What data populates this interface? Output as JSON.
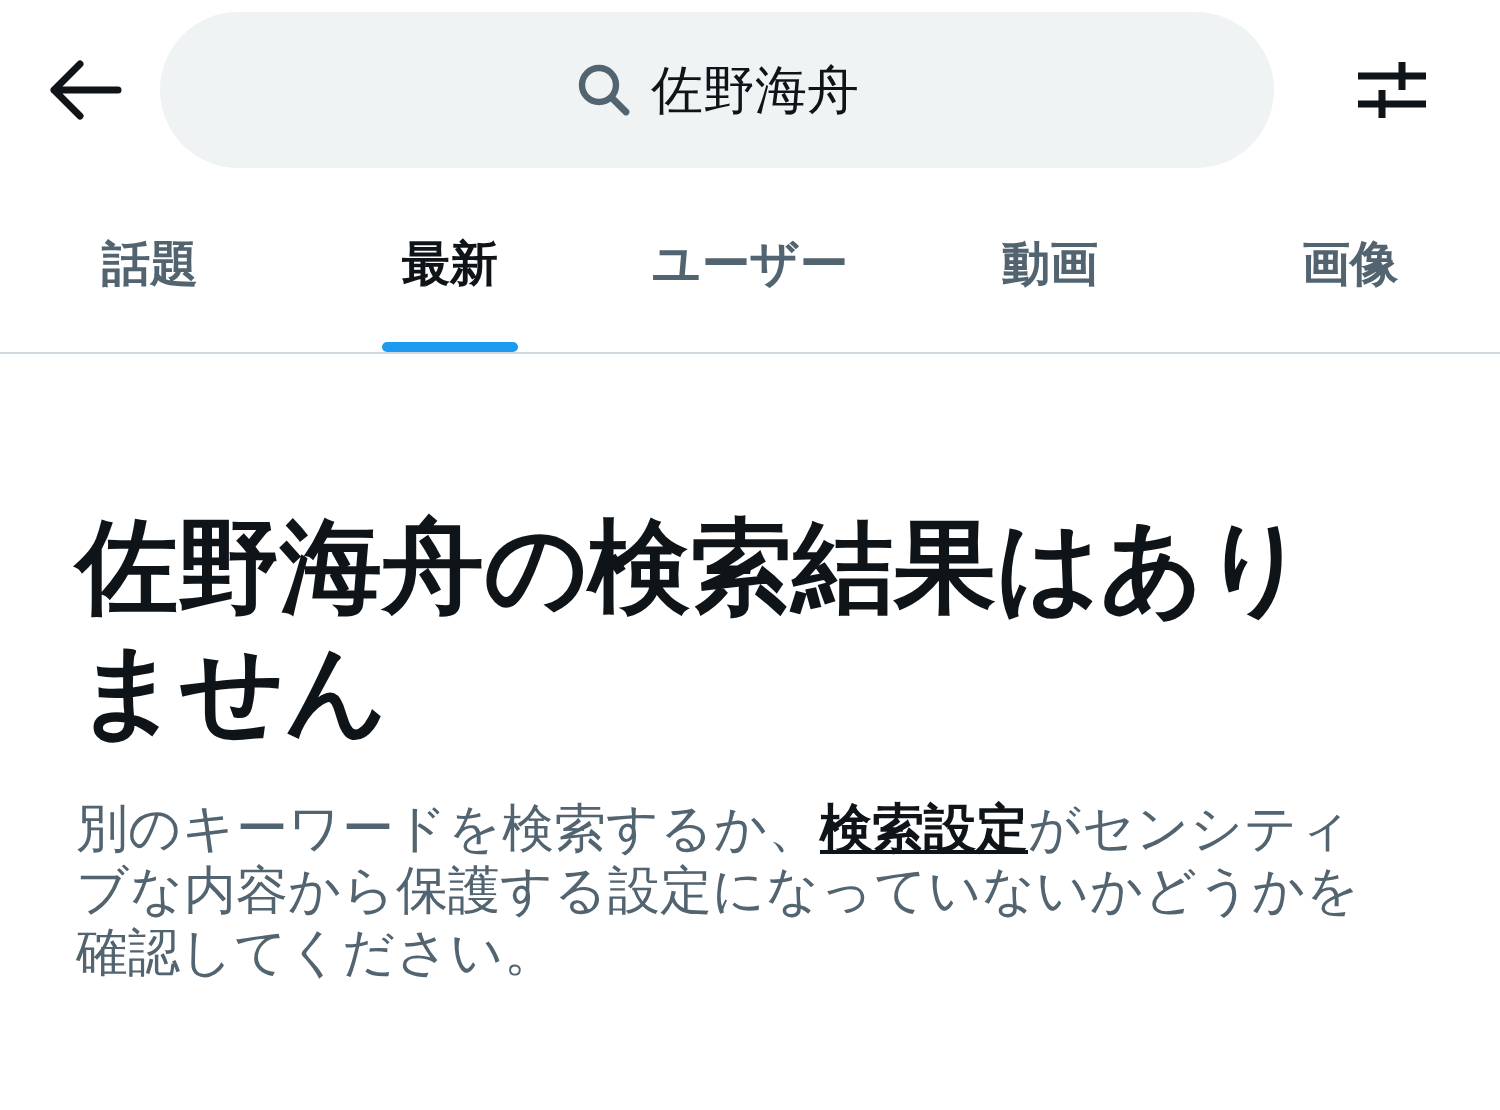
{
  "search": {
    "value": "佐野海舟"
  },
  "tabs": [
    {
      "label": "話題",
      "selected": false
    },
    {
      "label": "最新",
      "selected": true
    },
    {
      "label": "ユーザー",
      "selected": false
    },
    {
      "label": "動画",
      "selected": false
    },
    {
      "label": "画像",
      "selected": false
    }
  ],
  "empty_state": {
    "title": "佐野海舟の検索結果はありません",
    "message_before": "別のキーワードを検索するか、",
    "message_link": "検索設定",
    "message_after": "がセンシティブな内容から保護する設定になっていないかどうかを確認してください。"
  }
}
